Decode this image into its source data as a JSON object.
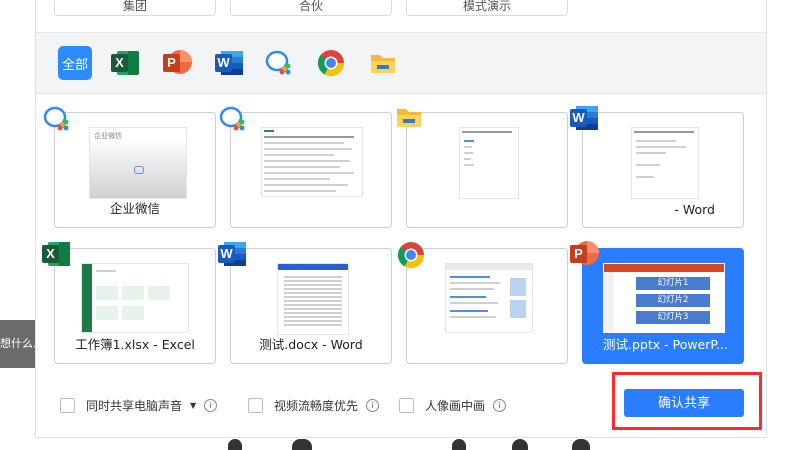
{
  "background": {
    "left_snippet": "想什么..."
  },
  "top_tabs": [
    "集团",
    "合伙",
    "模式演示"
  ],
  "filters": [
    {
      "label": "全部",
      "icon": "all",
      "active": true
    },
    {
      "icon": "excel-icon"
    },
    {
      "icon": "powerpoint-icon"
    },
    {
      "icon": "word-icon"
    },
    {
      "icon": "wecom-icon"
    },
    {
      "icon": "chrome-icon"
    },
    {
      "icon": "folder-icon"
    }
  ],
  "windows": [
    {
      "label": "企业微信",
      "app": "wecom",
      "thumb_text": "企业微信"
    },
    {
      "label": "",
      "app": "wecom"
    },
    {
      "label": "",
      "app": "folder"
    },
    {
      "label": "- Word",
      "app": "word"
    },
    {
      "label": "工作簿1.xlsx - Excel",
      "app": "excel"
    },
    {
      "label": "测试.docx - Word",
      "app": "word"
    },
    {
      "label": "",
      "app": "chrome"
    },
    {
      "label": "测试.pptx - PowerP...",
      "app": "powerpoint",
      "selected": true,
      "slides": [
        "幻灯片1",
        "幻灯片2",
        "幻灯片3"
      ]
    }
  ],
  "options": {
    "share_audio": "同时共享电脑声音",
    "video_smooth": "视频流畅度优先",
    "portrait_pip": "人像画中画",
    "info_glyph": "i",
    "caret_glyph": "▼"
  },
  "confirm_button": "确认共享",
  "colors": {
    "accent": "#2a7dff",
    "highlight": "#ff2a2a",
    "excel": "#1f7a45",
    "word": "#2b5fcb",
    "ppt": "#d24726"
  }
}
